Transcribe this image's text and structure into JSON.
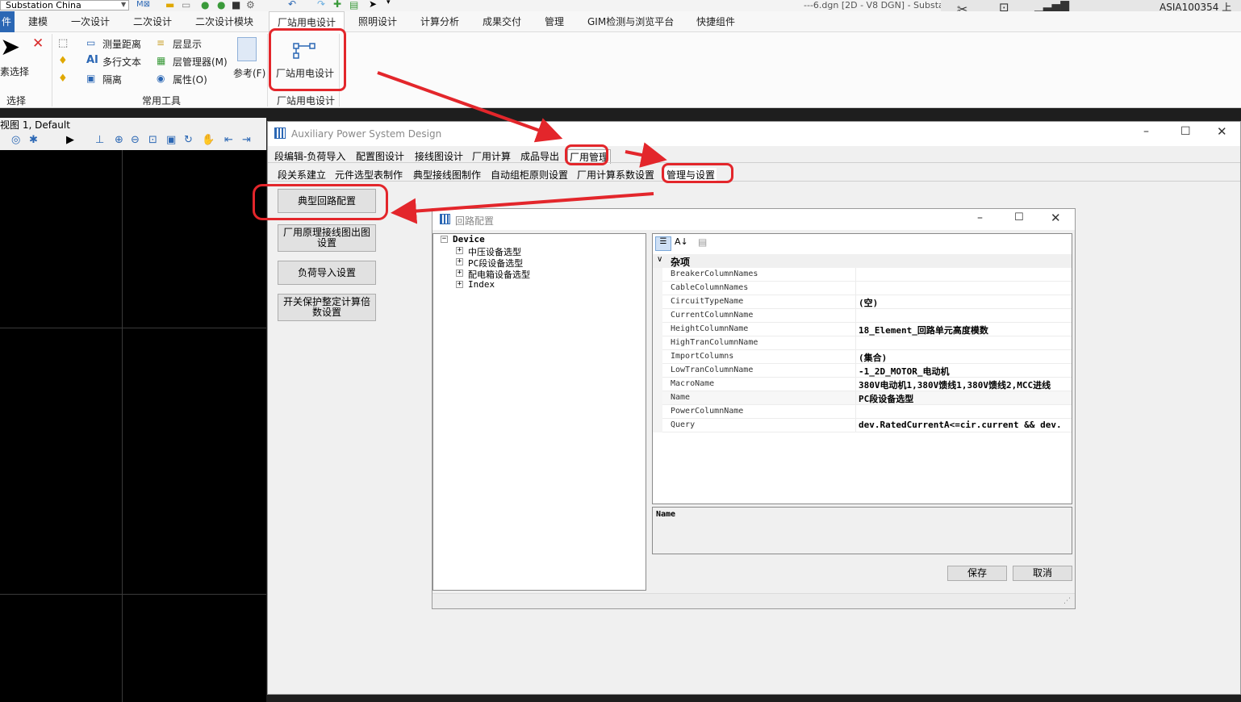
{
  "app": {
    "name": "Substation China",
    "window_title": "---6.dgn [2D - V8 DGN] - Substa",
    "user": "ASIA100354 上"
  },
  "ribbon": {
    "tabs": [
      "件",
      "建模",
      "一次设计",
      "二次设计",
      "二次设计模块",
      "厂站用电设计",
      "照明设计",
      "计算分析",
      "成果交付",
      "管理",
      "GIM检测与浏览平台",
      "快捷组件"
    ],
    "active_tab": "厂站用电设计",
    "groups": {
      "select": {
        "label": "选择",
        "button": "素选择"
      },
      "tools": {
        "label": "常用工具",
        "items": [
          "测量距离",
          "层显示",
          "多行文本",
          "层管理器(M)",
          "隔离",
          "属性(O)",
          "参考(F)"
        ]
      },
      "station": {
        "label": "厂站用电设计",
        "button": "厂站用电设计"
      }
    }
  },
  "view": {
    "title": "视图 1, Default"
  },
  "aux_window": {
    "title": "Auxiliary Power System Design",
    "tabs_row1": [
      "段编辑-负荷导入",
      "配置图设计",
      "接线图设计",
      "厂用计算",
      "成品导出",
      "厂用管理"
    ],
    "active_tab1": "厂用管理",
    "tabs_row2": [
      "段关系建立",
      "元件选型表制作",
      "典型接线图制作",
      "自动组柜原则设置",
      "厂用计算系数设置",
      "管理与设置"
    ],
    "active_tab2": "管理与设置",
    "side_buttons": [
      "典型回路配置",
      "厂用原理接线图出图设置",
      "负荷导入设置",
      "开关保护整定计算倍数设置"
    ]
  },
  "dialog": {
    "title": "回路配置",
    "tree": {
      "root": "Device",
      "children": [
        "中压设备选型",
        "PC段设备选型",
        "配电箱设备选型",
        "Index"
      ]
    },
    "property_grid": {
      "category": "杂项",
      "rows": [
        {
          "name": "BreakerColumnNames",
          "value": ""
        },
        {
          "name": "CableColumnNames",
          "value": ""
        },
        {
          "name": "CircuitTypeName",
          "value": "(空)"
        },
        {
          "name": "CurrentColumnName",
          "value": ""
        },
        {
          "name": "HeightColumnName",
          "value": "18_Element_回路单元高度模数"
        },
        {
          "name": "HighTranColumnName",
          "value": ""
        },
        {
          "name": "ImportColumns",
          "value": "(集合)"
        },
        {
          "name": "LowTranColumnName",
          "value": "-1_2D_MOTOR_电动机"
        },
        {
          "name": "MacroName",
          "value": "380V电动机1,380V馈线1,380V馈线2,MCC进线"
        },
        {
          "name": "Name",
          "value": "PC段设备选型"
        },
        {
          "name": "PowerColumnName",
          "value": ""
        },
        {
          "name": "Query",
          "value": "dev.RatedCurrentA<=cir.current && dev."
        }
      ]
    },
    "description_title": "Name",
    "save_label": "保存",
    "cancel_label": "取消"
  }
}
